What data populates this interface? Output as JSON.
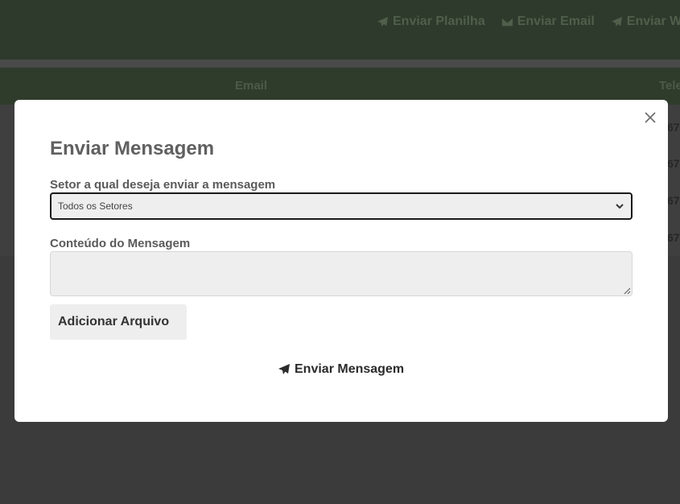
{
  "background": {
    "toolbar": {
      "actions": [
        {
          "label": "Enviar Planilha",
          "icon": "paper-plane-icon"
        },
        {
          "label": "Enviar Email",
          "icon": "envelope-icon"
        },
        {
          "label": "Enviar W",
          "icon": "paper-plane-icon"
        }
      ]
    },
    "table": {
      "headers": [
        "Email",
        "Tele"
      ],
      "cells": [
        "67",
        "67",
        "67",
        "67"
      ]
    }
  },
  "modal": {
    "title": "Enviar Mensagem",
    "setor": {
      "label": "Setor a qual deseja enviar a mensagem",
      "selected": "Todos os Setores"
    },
    "conteudo": {
      "label": "Conteúdo do Mensagem",
      "value": ""
    },
    "add_file_label": "Adicionar Arquivo",
    "send_label": "Enviar Mensagem"
  },
  "colors": {
    "overlay_bg": "#3b3b3b",
    "toolbar_bg": "#2e3a2c",
    "modal_bg": "#ffffff",
    "input_bg": "#eeeeee"
  }
}
